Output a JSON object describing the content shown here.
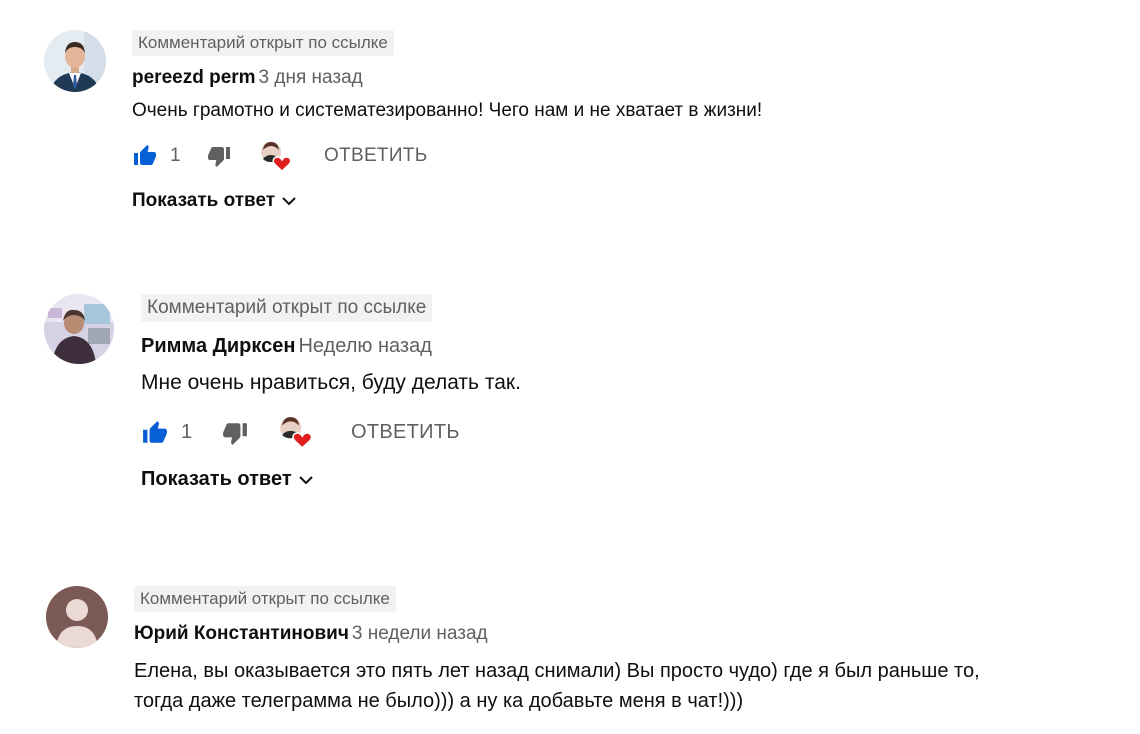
{
  "comments": [
    {
      "badge": "Комментарий открыт по ссылке",
      "author": "pereezd perm",
      "time": "3 дня назад",
      "text": "Очень грамотно и систематезированно! Чего нам и не хватает в жизни!",
      "likes": "1",
      "reply_label": "ОТВЕТИТЬ",
      "show_replies": "Показать ответ",
      "avatar": "photo-man-in-suit"
    },
    {
      "badge": "Комментарий открыт по ссылке",
      "author": "Римма Дирксен",
      "time": "Неделю назад",
      "text": "Мне очень нравиться, буду делать так.",
      "likes": "1",
      "reply_label": "ОТВЕТИТЬ",
      "show_replies": "Показать ответ",
      "avatar": "photo-woman-indoors"
    },
    {
      "badge": "Комментарий открыт по ссылке",
      "author": "Юрий Константинович",
      "time": "3 недели назад",
      "text_lines": [
        "Елена, вы оказывается это пять лет назад снимали) Вы просто чудо) где я был раньше то,",
        "тогда даже телеграмма не было))) а ну ка добавьте меня в чат!)))"
      ],
      "avatar": "default-user-icon"
    }
  ],
  "colors": {
    "like_active": "#065fd4",
    "dislike": "#606060",
    "heart": "#e01e1e",
    "badge_bg": "#f2f2f2",
    "secondary_text": "#606060",
    "default_avatar_bg": "#7b5a55"
  }
}
